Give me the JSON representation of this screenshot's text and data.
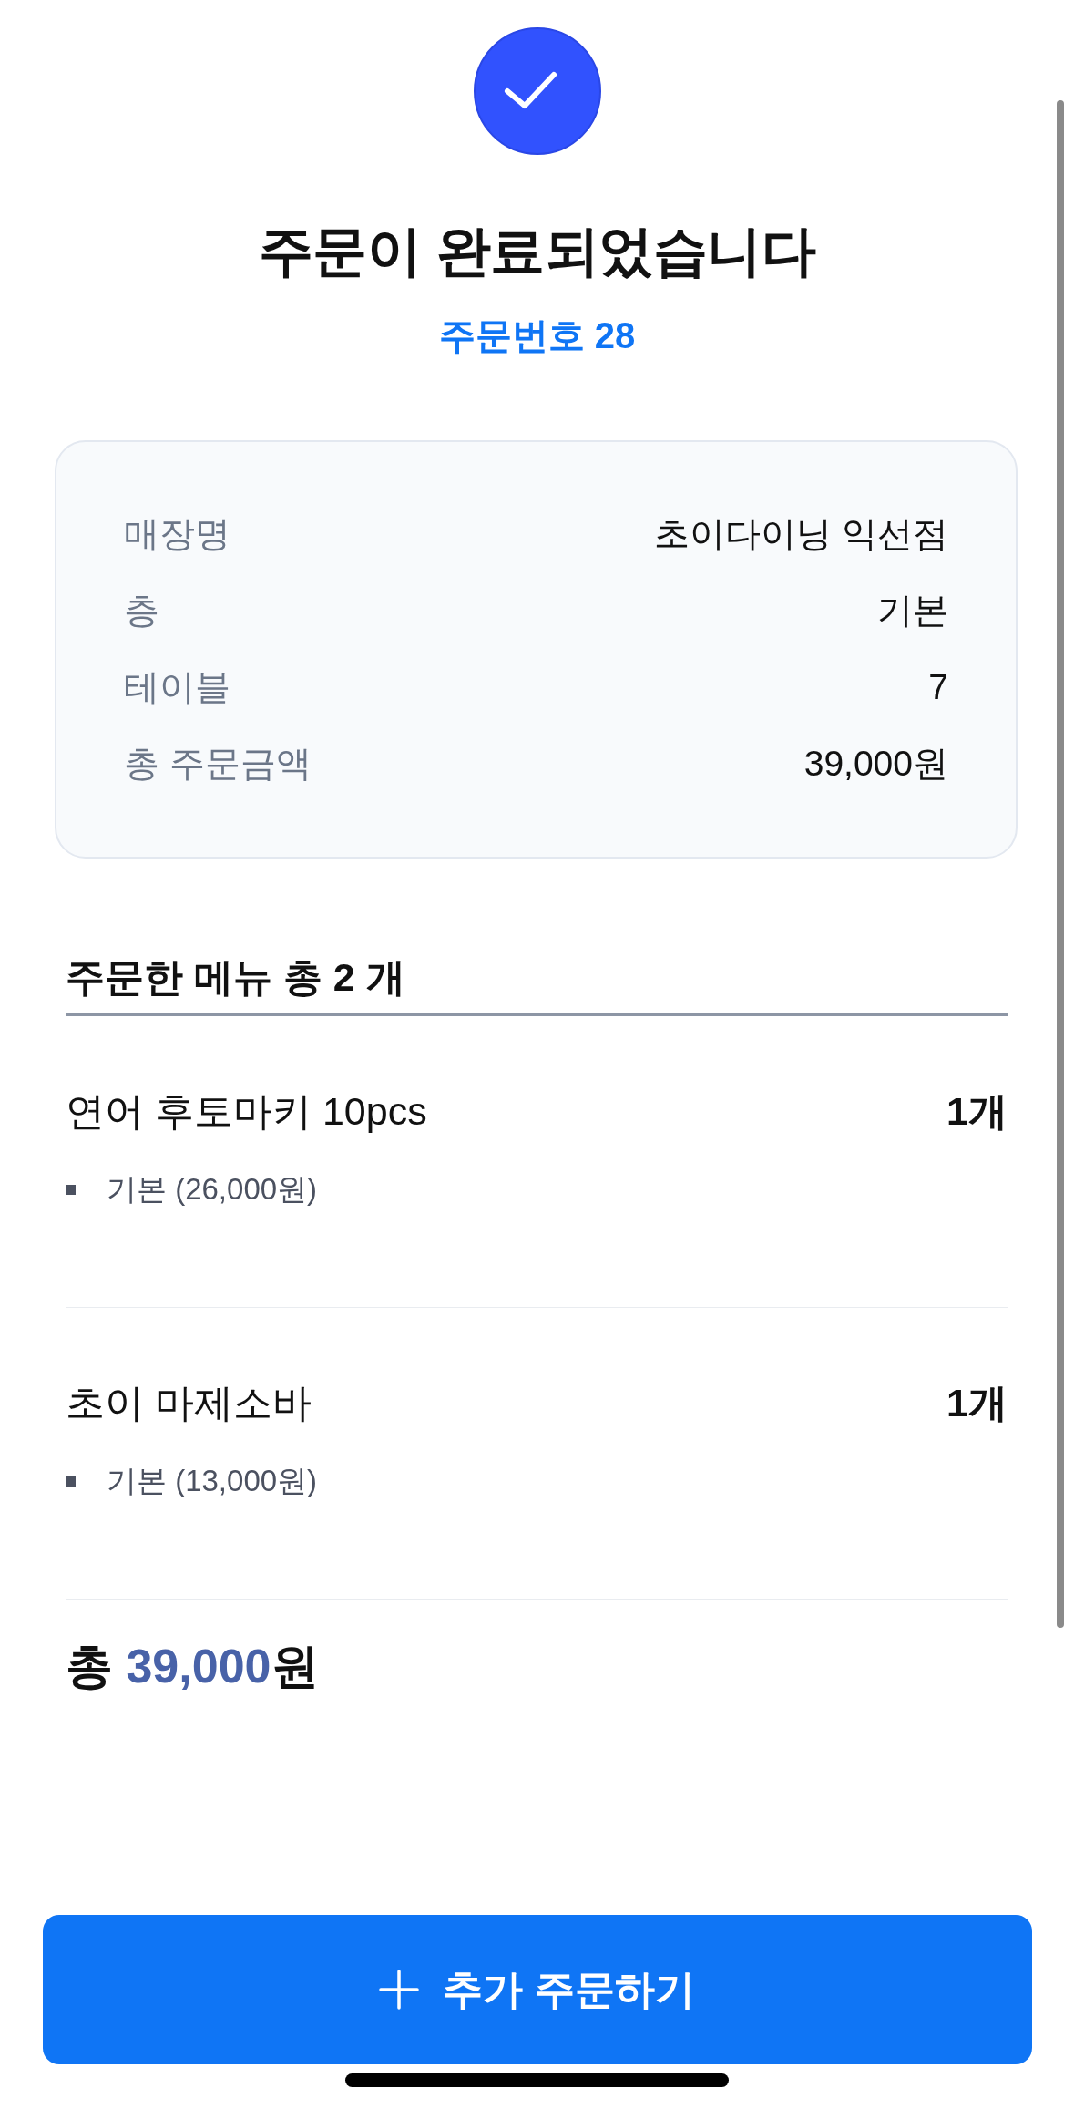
{
  "status": {
    "title": "주문이 완료되었습니다",
    "order_number": "주문번호 28"
  },
  "summary": [
    {
      "label": "매장명",
      "value": "초이다이닝 익선점"
    },
    {
      "label": "층",
      "value": "기본"
    },
    {
      "label": "테이블",
      "value": "7"
    },
    {
      "label": "총 주문금액",
      "value": "39,000원"
    }
  ],
  "menu": {
    "heading": "주문한 메뉴 총 2 개",
    "items": [
      {
        "name": "연어 후토마키 10pcs",
        "quantity": "1개",
        "options": [
          "기본 (26,000원)"
        ]
      },
      {
        "name": "초이 마제소바",
        "quantity": "1개",
        "options": [
          "기본 (13,000원)"
        ]
      }
    ]
  },
  "total": {
    "label": "총",
    "amount": "39,000",
    "unit": "원"
  },
  "button": {
    "label": "추가 주문하기"
  }
}
